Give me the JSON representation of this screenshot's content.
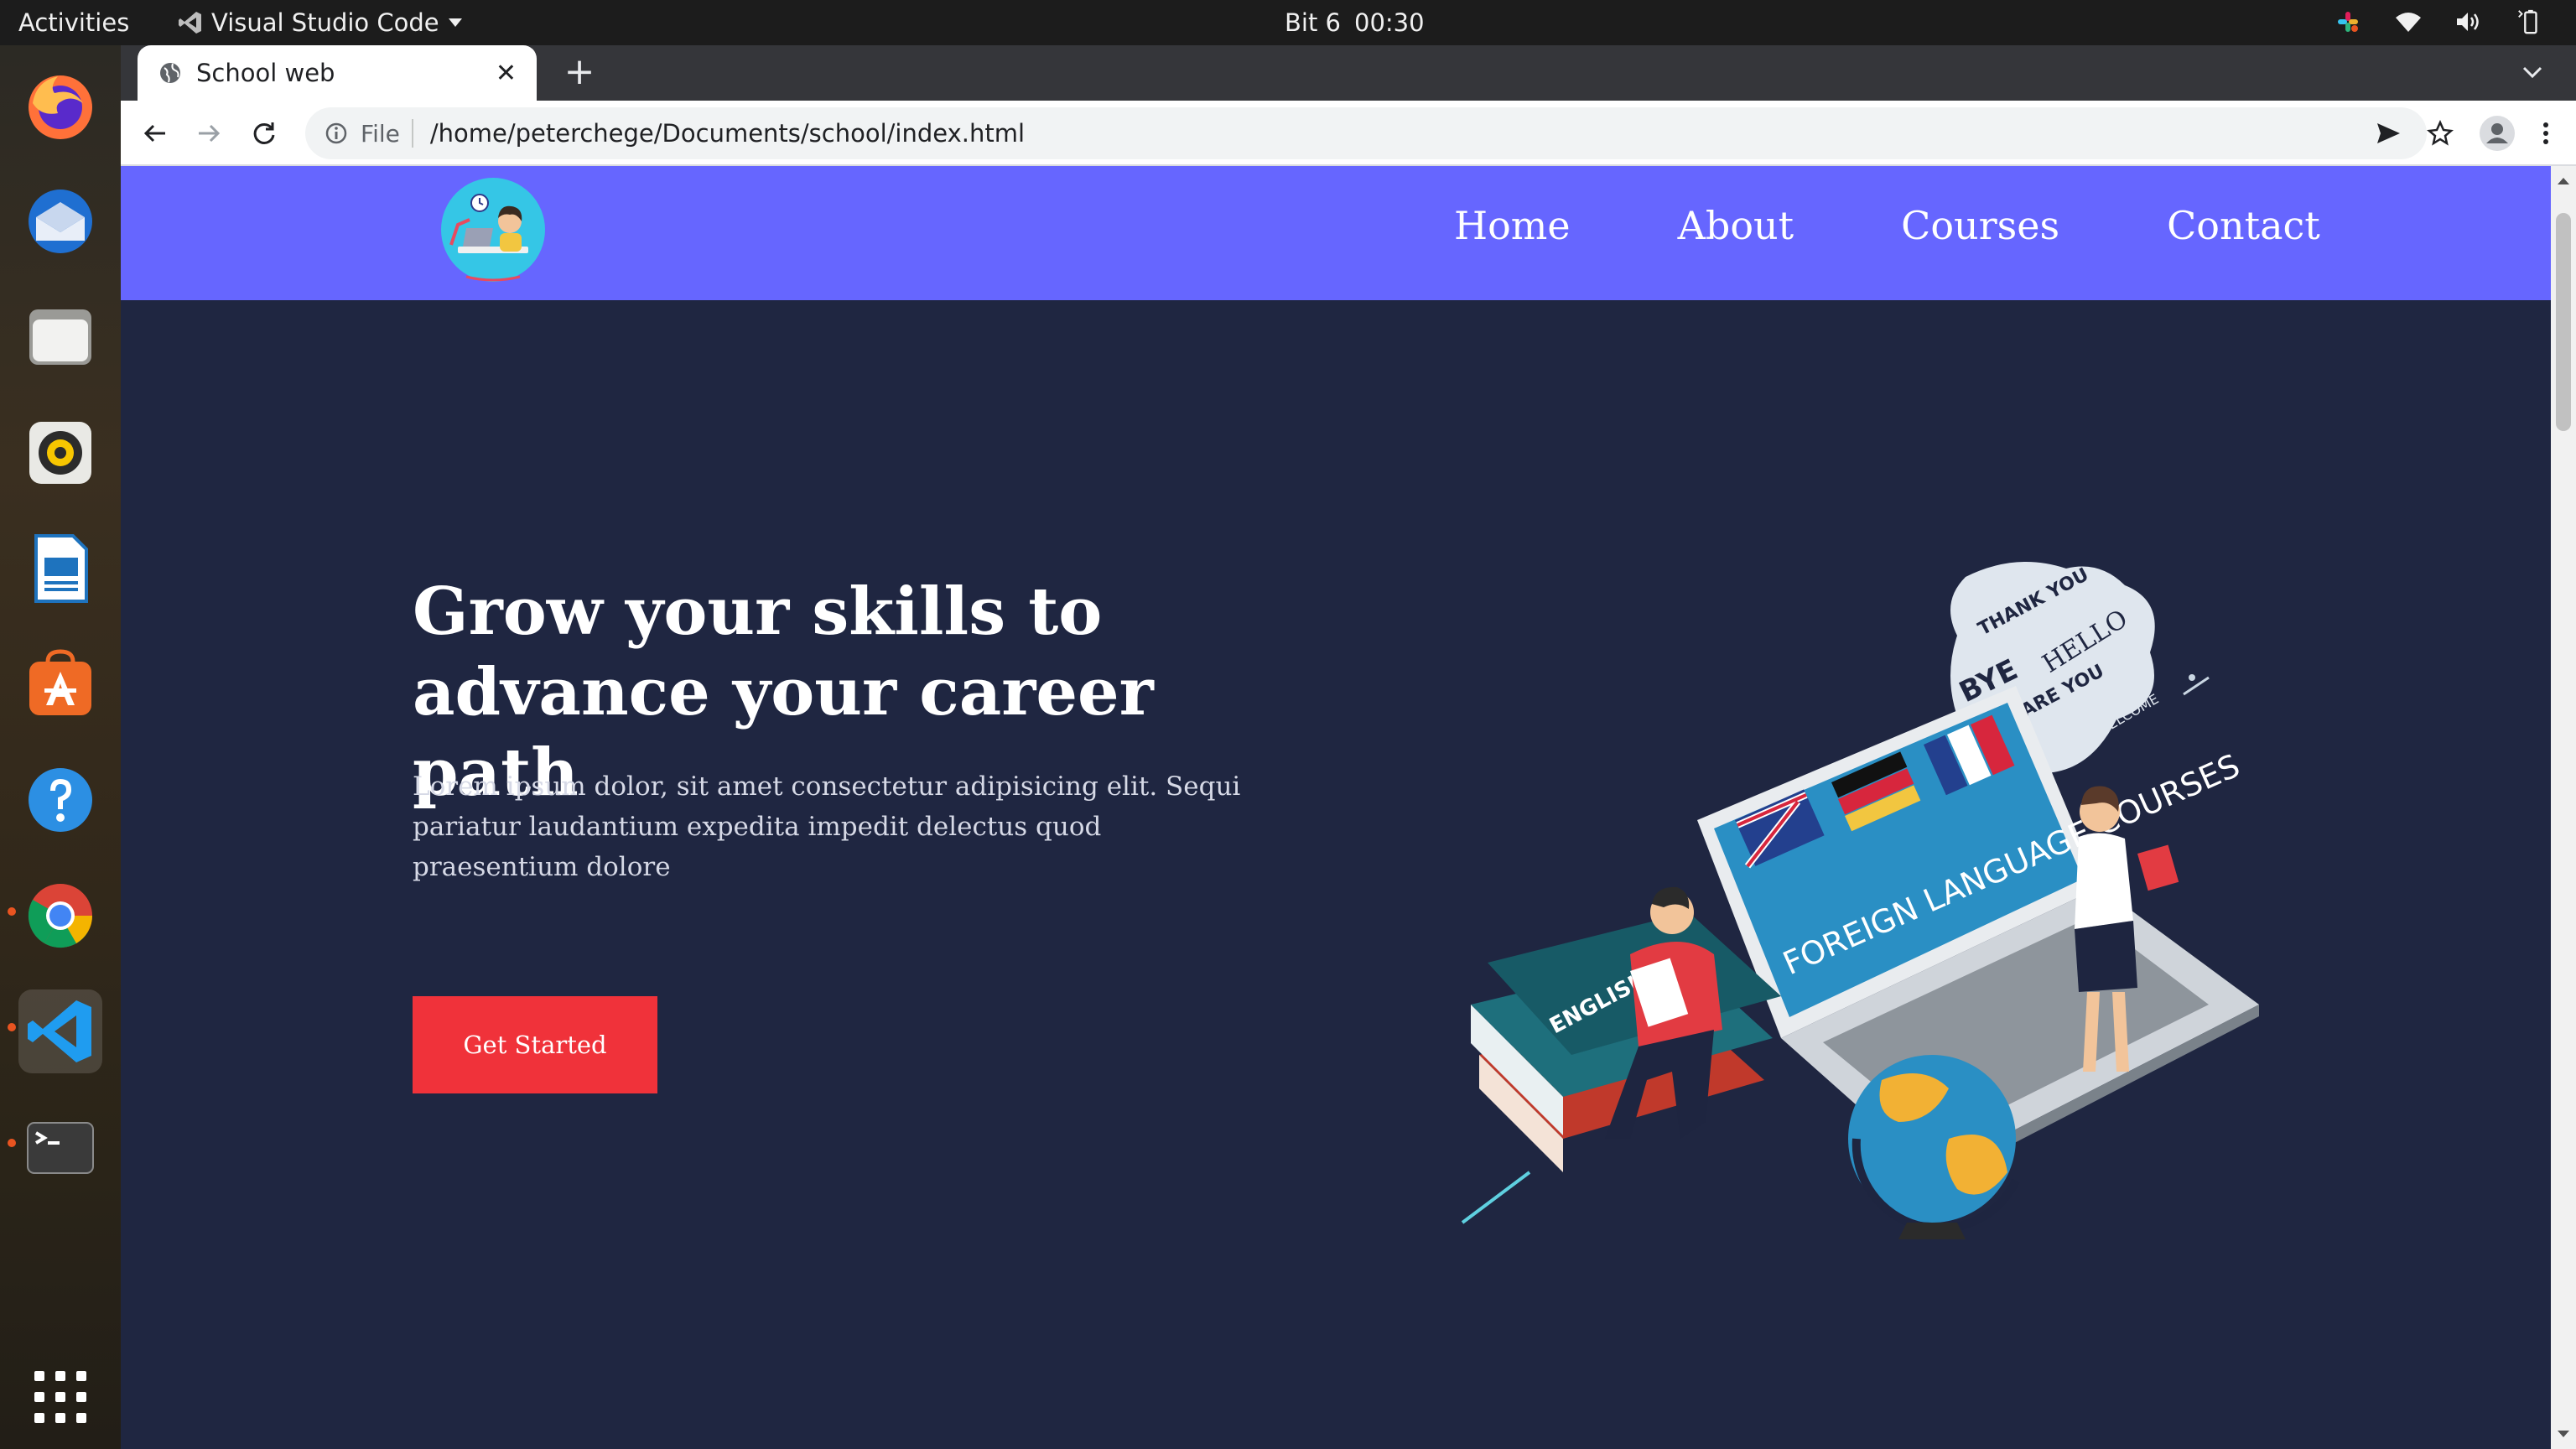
{
  "topbar": {
    "activities": "Activities",
    "app_name": "Visual Studio Code",
    "day": "Bit 6",
    "time": "00:30"
  },
  "dock": {
    "items": [
      "firefox",
      "thunderbird",
      "files",
      "rhythmbox",
      "libreoffice-writer",
      "ubuntu-software",
      "help",
      "chrome",
      "vscode",
      "terminal",
      "show-applications"
    ]
  },
  "browser": {
    "tab_title": "School web",
    "address_scheme": "File",
    "address_url": "/home/peterchege/Documents/school/index.html"
  },
  "site": {
    "nav": [
      "Home",
      "About",
      "Courses",
      "Contact"
    ],
    "hero_title": "Grow your skills to advance your career path",
    "hero_text": "Lorem ipsum dolor, sit amet consectetur adipisicing elit. Sequi pariatur laudantium expedita impedit delectus quod praesentium dolore",
    "cta_label": "Get Started",
    "illustration_text": {
      "laptop": "FOREIGN LANGUAGE COURSES",
      "bubble": [
        "THANK YOU",
        "HELLO",
        "BYE",
        "HOW ARE YOU",
        "WELCOME"
      ],
      "book": "ENGLISH DIC"
    }
  },
  "colors": {
    "nav_bg": "#6666ff",
    "page_bg": "#1f2641",
    "cta_bg": "#f0323a",
    "topbar_bg": "#1c1c1c",
    "tabstrip_bg": "#35363a"
  }
}
